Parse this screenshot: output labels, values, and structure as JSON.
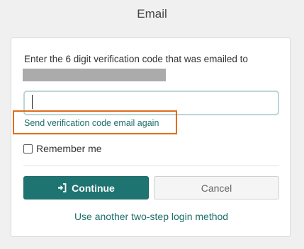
{
  "header": {
    "title": "Email"
  },
  "form": {
    "instruction": "Enter the 6 digit verification code that was emailed to",
    "code_input": {
      "value": "",
      "placeholder": ""
    },
    "resend_link": "Send verification code email again",
    "remember_label": "Remember me",
    "remember_checked": false,
    "continue_label": "Continue",
    "continue_icon": "sign-in-arrow-icon",
    "cancel_label": "Cancel",
    "alt_method_link": "Use another two-step login method"
  },
  "colors": {
    "primary": "#1e7471",
    "link": "#1d6f6b",
    "highlight": "#e36c1a",
    "redaction": "#ababab"
  }
}
